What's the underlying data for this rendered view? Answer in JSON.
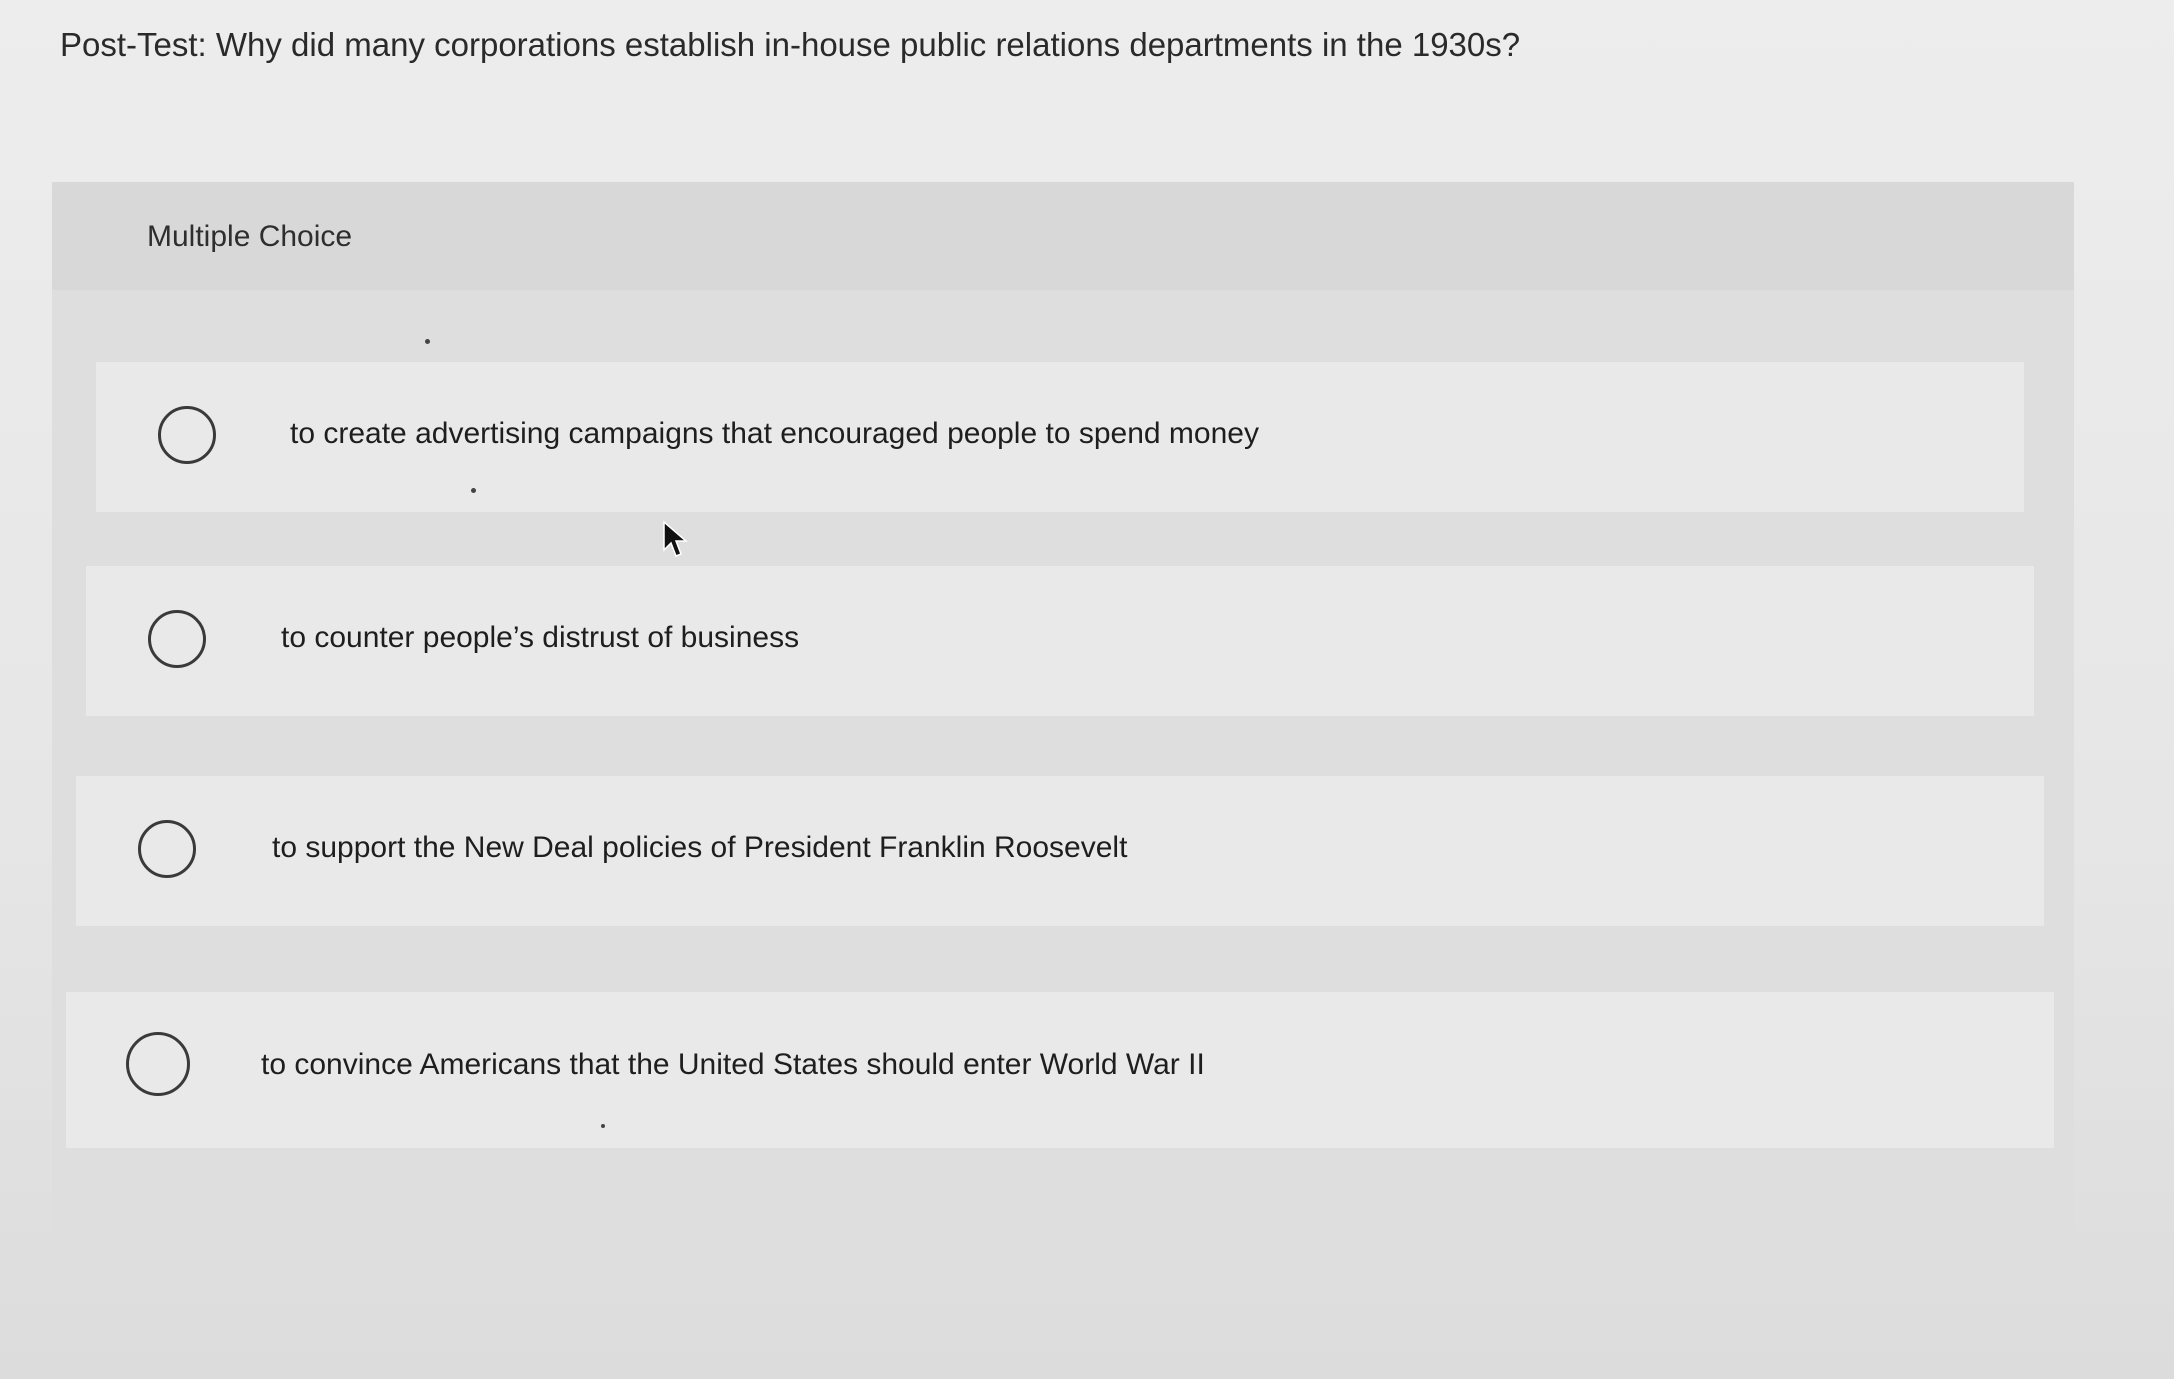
{
  "question": {
    "text": "Post-Test: Why did many corporations establish in-house public relations departments in the 1930s?"
  },
  "panel": {
    "header": "Multiple Choice",
    "options": [
      {
        "label": "to create advertising campaigns that encouraged people to spend money",
        "selected": false
      },
      {
        "label": "to counter people’s distrust of business",
        "selected": false
      },
      {
        "label": "to support the New Deal policies of President Franklin Roosevelt",
        "selected": false
      },
      {
        "label": "to convince Americans that the United States should enter World War II",
        "selected": false
      }
    ]
  },
  "icons": {
    "radio": "radio-unchecked-icon",
    "cursor": "mouse-pointer-icon"
  }
}
